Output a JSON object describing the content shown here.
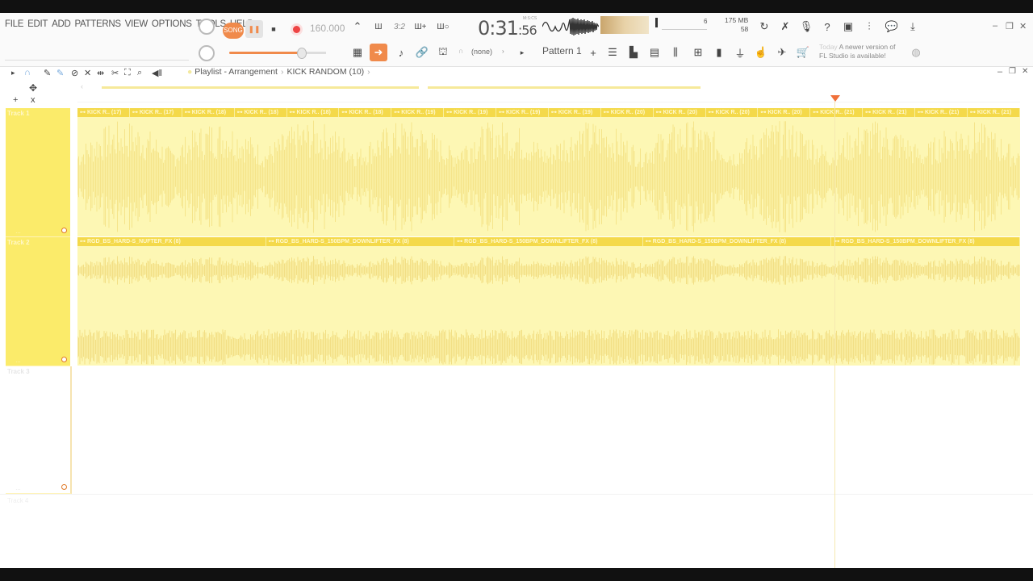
{
  "menu": [
    "FILE",
    "EDIT",
    "ADD",
    "PATTERNS",
    "VIEW",
    "OPTIONS",
    "TOOLS",
    "HELP"
  ],
  "transport": {
    "mode_label": "SONG",
    "tempo": "160.000",
    "time_main": "0:31",
    "time_sub": ":56",
    "time_units": "M:S:CS"
  },
  "stats": {
    "cpu": "6",
    "memory": "175 MB",
    "polyphony": "58"
  },
  "news": {
    "today": "Today",
    "text_line1": "A newer version of",
    "text_line2": "FL Studio is available!"
  },
  "pattern": {
    "none_label": "(none)",
    "current": "Pattern 1"
  },
  "breadcrumb": {
    "root": "Playlist - Arrangement",
    "current": "KICK RANDOM (10)"
  },
  "tracks": [
    {
      "name": "Track 1"
    },
    {
      "name": "Track 2"
    },
    {
      "name": "Track 3"
    },
    {
      "name": "Track 4"
    }
  ],
  "track1_clips": [
    "KICK R.. (17)",
    "KICK R.. (17)",
    "KICK R.. (18)",
    "KICK R.. (18)",
    "KICK R.. (18)",
    "KICK R.. (18)",
    "KICK R.. (19)",
    "KICK R.. (19)",
    "KICK R.. (19)",
    "KICK R.. (19)",
    "KICK R.. (20)",
    "KICK R.. (20)",
    "KICK R.. (20)",
    "KICK R.. (20)",
    "KICK R.. (21)",
    "KICK R.. (21)",
    "KICK R.. (21)",
    "KICK R.. (21)"
  ],
  "track2_clips": [
    "RGD_BS_HARD-S_NUFTER_FX (8)",
    "RGD_BS_HARD-S_150BPM_DOWNLIFTER_FX (8)",
    "RGD_BS_HARD-S_150BPM_DOWNLIFTER_FX (8)",
    "RGD_BS_HARD-S_150BPM_DOWNLIFTER_FX (8)",
    "RGD_BS_HARD-S_150BPM_DOWNLIFTER_FX (8)"
  ],
  "colors": {
    "accent": "#f08a4b",
    "clip": "#fbeb6a",
    "clip_label": "#f4d94a",
    "marker": "#f0703a"
  }
}
